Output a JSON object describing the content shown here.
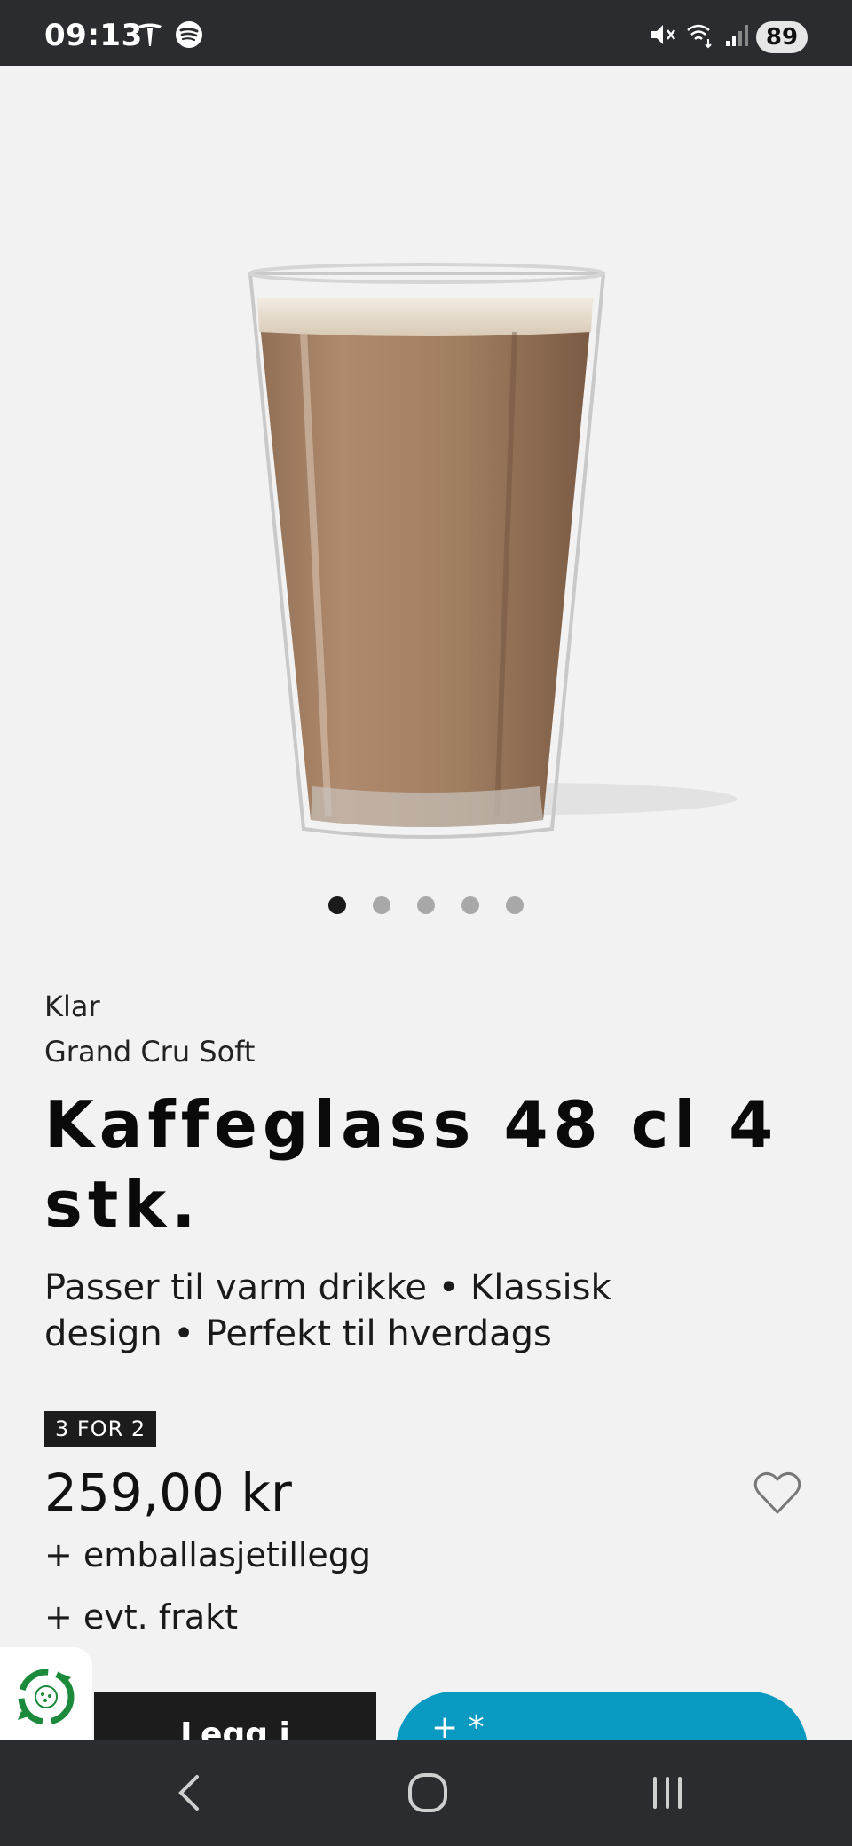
{
  "status_bar": {
    "time": "09:13",
    "battery": "89",
    "icons": [
      "tesla-icon",
      "spotify-icon",
      "mute-icon",
      "wifi-icon",
      "signal-icon"
    ]
  },
  "gallery": {
    "image": "coffee-glass-image",
    "dot_count": 5,
    "active_index": 0
  },
  "product": {
    "brand": "Klar",
    "series": "Grand Cru Soft",
    "title": "Kaffeglass 48 cl 4 stk.",
    "features": "Passer til varm drikke • Klassisk design • Perfekt til hverdags",
    "promo": "3 FOR 2",
    "price": "259,00 kr",
    "packaging_fee": "+ emballasjetillegg",
    "shipping": "+ evt. frakt"
  },
  "actions": {
    "add_to_cart_label": "Legg i",
    "secondary_label": "+ *"
  },
  "colors": {
    "accent": "#0a9ac1",
    "dark": "#1c1c1c",
    "background": "#f2f2f2"
  }
}
